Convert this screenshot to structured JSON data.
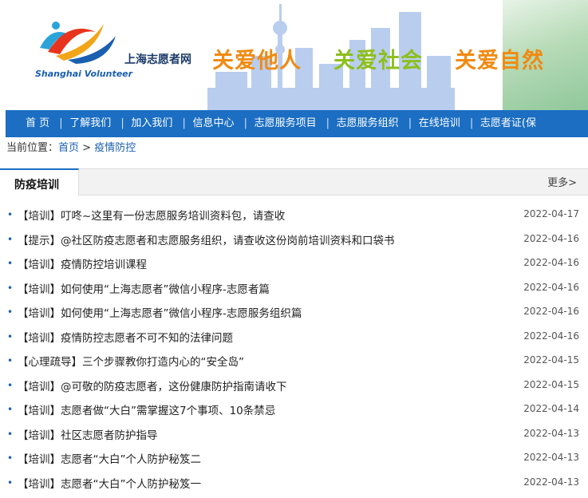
{
  "header": {
    "site_name_cn": "上海志愿者网",
    "site_name_en": "Shanghai Volunteer",
    "slogans": [
      "关爱他人",
      "关爱社会",
      "关爱自然"
    ]
  },
  "nav": {
    "items": [
      "首 页",
      "了解我们",
      "加入我们",
      "信息中心",
      "志愿服务项目",
      "志愿服务组织",
      "在线培训",
      "志愿者证(保"
    ]
  },
  "breadcrumb": {
    "label": "当前位置：",
    "home": "首页",
    "separator": " > ",
    "current": "疫情防控"
  },
  "panel": {
    "title": "防疫培训",
    "more": "更多>"
  },
  "articles": [
    {
      "title": "【培训】叮咚~这里有一份志愿服务培训资料包，请查收",
      "date": "2022-04-17"
    },
    {
      "title": "【提示】@社区防疫志愿者和志愿服务组织，请查收这份岗前培训资料和口袋书",
      "date": "2022-04-16"
    },
    {
      "title": "【培训】疫情防控培训课程",
      "date": "2022-04-16"
    },
    {
      "title": "【培训】如何使用“上海志愿者”微信小程序-志愿者篇",
      "date": "2022-04-16"
    },
    {
      "title": "【培训】如何使用“上海志愿者”微信小程序-志愿服务组织篇",
      "date": "2022-04-16"
    },
    {
      "title": "【培训】疫情防控志愿者不可不知的法律问题",
      "date": "2022-04-16"
    },
    {
      "title": "【心理疏导】三个步骤教你打造内心的“安全岛”",
      "date": "2022-04-15"
    },
    {
      "title": "【培训】@可敬的防疫志愿者，这份健康防护指南请收下",
      "date": "2022-04-15"
    },
    {
      "title": "【培训】志愿者做“大白”需掌握这7个事项、10条禁忌",
      "date": "2022-04-14"
    },
    {
      "title": "【培训】社区志愿者防护指导",
      "date": "2022-04-13"
    },
    {
      "title": "【培训】志愿者“大白”个人防护秘笈二",
      "date": "2022-04-13"
    },
    {
      "title": "【培训】志愿者“大白”个人防护秘笈一",
      "date": "2022-04-13"
    }
  ]
}
